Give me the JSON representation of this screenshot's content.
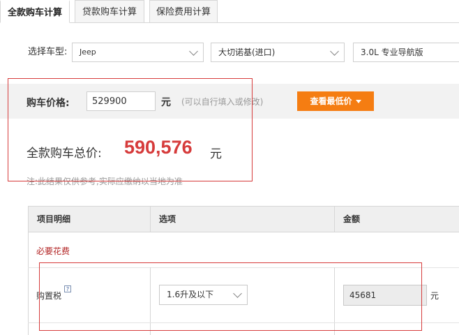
{
  "tabs": [
    {
      "label": "全款购车计算",
      "active": true
    },
    {
      "label": "贷款购车计算",
      "active": false
    },
    {
      "label": "保险费用计算",
      "active": false
    }
  ],
  "car_select": {
    "label": "选择车型:",
    "brand": "Jeep",
    "series": "大切诺基(进口)",
    "model": "3.0L 专业导航版"
  },
  "price": {
    "label": "购车价格:",
    "value": "529900",
    "unit": "元",
    "hint": "(可以自行填入或修改)",
    "button_label": "查看最低价"
  },
  "total": {
    "label": "全款购车总价:",
    "value": "590,576",
    "unit": "元",
    "note": "注:此结果仅供参考,实际应缴纳以当地为准"
  },
  "table": {
    "headers": [
      "项目明细",
      "选项",
      "金额"
    ],
    "section_title": "必要花费",
    "rows": [
      {
        "item": "购置税",
        "help": "?",
        "option": "1.6升及以下",
        "amount": "45681",
        "unit": "元"
      }
    ]
  },
  "colors": {
    "accent_orange": "#f57d12",
    "total_red": "#d63b3b",
    "section_red": "#b22222",
    "annotation_red": "#d63b3b"
  }
}
